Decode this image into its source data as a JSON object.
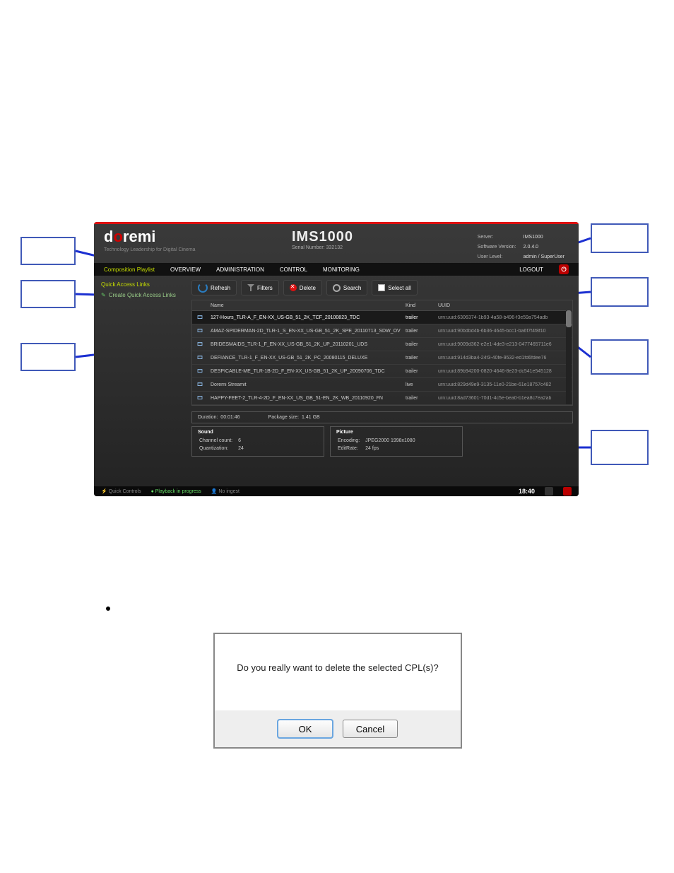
{
  "logo": {
    "pre": "d",
    "o": "o",
    "post": "remi"
  },
  "tagline": "Technology Leadership for Digital Cinema",
  "product": {
    "name": "IMS1000",
    "serial_label": "Serial Number:",
    "serial": "332132"
  },
  "server_info": {
    "server_label": "Server:",
    "server": "IMS1000",
    "sw_label": "Software Version:",
    "sw": "2.0.4.0",
    "user_label": "User Level:",
    "user": "admin / SuperUser"
  },
  "nav": {
    "t0": "Composition Playlist",
    "t1": "OVERVIEW",
    "t2": "ADMINISTRATION",
    "t3": "CONTROL",
    "t4": "MONITORING",
    "logout": "LOGOUT"
  },
  "sidebar": {
    "title": "Quick Access Links",
    "create": "Create Quick Access Links"
  },
  "toolbar": {
    "refresh": "Refresh",
    "filters": "Filters",
    "delete": "Delete",
    "search": "Search",
    "selectall": "Select all"
  },
  "columns": {
    "name": "Name",
    "kind": "Kind",
    "uuid": "UUID"
  },
  "rows": [
    {
      "name": "127-Hours_TLR-A_F_EN-XX_US-GB_51_2K_TCF_20100823_TDC",
      "kind": "trailer",
      "uuid": "urn:uuid:6306374-1b93-4a58-b496-f3e59a754adb",
      "sel": true
    },
    {
      "name": "AMAZ-SPIDERMAN-2D_TLR-1_S_EN-XX_US-GB_51_2K_SPE_20110713_SDW_OV",
      "kind": "trailer",
      "uuid": "urn:uuid:90bdbd4b-6b36-4645-bcc1-ba6f7f4f8f10"
    },
    {
      "name": "BRIDESMAIDS_TLR-1_F_EN-XX_US-GB_51_2K_UP_20110201_UDS",
      "kind": "trailer",
      "uuid": "urn:uuid:9009d362-e2e1-4de3-e213-0477465711e6"
    },
    {
      "name": "DEFIANCE_TLR-1_F_EN-XX_US-GB_51_2K_PC_20080115_DELUXE",
      "kind": "trailer",
      "uuid": "urn:uuid:914d3ba4-24f3-40fe-9532-ed1fd6fdee76"
    },
    {
      "name": "DESPICABLE-ME_TLR-1B-2D_F_EN-XX_US-GB_51_2K_UP_20090706_TDC",
      "kind": "trailer",
      "uuid": "urn:uuid:89b94200-0820-4646-8e23-dc541e545128"
    },
    {
      "name": "Doremi Streamit",
      "kind": "live",
      "uuid": "urn:uuid:829d49e9-3135-11e0-21be-61e18757c482"
    },
    {
      "name": "HAPPY-FEET-2_TLR-4-2D_F_EN-XX_US_GB_51-EN_2K_WB_20110920_FN",
      "kind": "trailer",
      "uuid": "urn:uuid:8ad73601-70d1-4c5e-bea0-b1ea8c7ea2ab"
    }
  ],
  "duration": {
    "label": "Duration:",
    "value": "00:01:46",
    "pkg_label": "Package size:",
    "pkg": "1.41 GB"
  },
  "sound": {
    "title": "Sound",
    "cc_label": "Channel count:",
    "cc": "6",
    "q_label": "Quantization:",
    "q": "24"
  },
  "picture": {
    "title": "Picture",
    "enc_label": "Encoding:",
    "enc": "JPEG2000 1998x1080",
    "er_label": "EditRate:",
    "er": "24 fps"
  },
  "status": {
    "quick": "Quick Controls",
    "pb": "Playback in progress",
    "ing": "No ingest",
    "clock": "18:40"
  },
  "dialog": {
    "msg": "Do you really want to delete the selected CPL(s)?",
    "ok": "OK",
    "cancel": "Cancel"
  }
}
